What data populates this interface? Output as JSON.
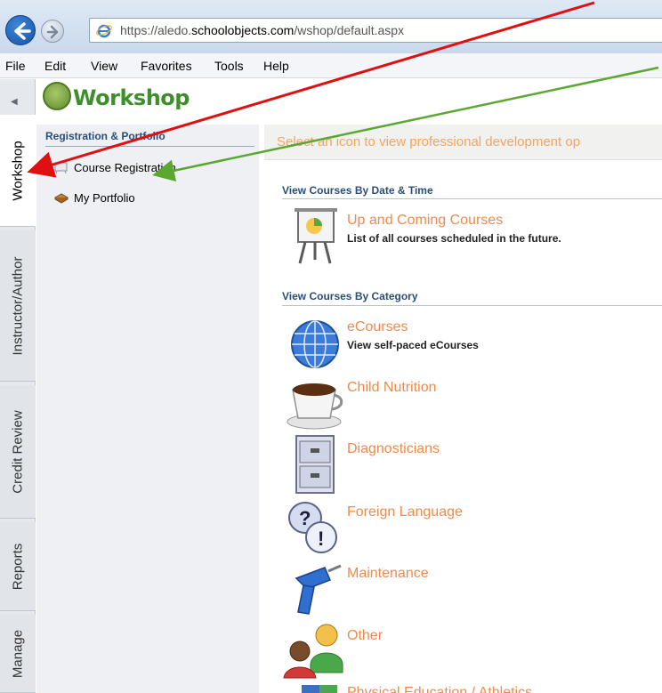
{
  "browser": {
    "url_prefix": "https://aledo.",
    "url_domain": "schoolobjects.com",
    "url_path": "/wshop/default.aspx"
  },
  "menu": [
    "File",
    "Edit",
    "View",
    "Favorites",
    "Tools",
    "Help"
  ],
  "side_tabs": [
    "Workshop",
    "Instructor/Author",
    "Credit Review",
    "Reports",
    "Manage"
  ],
  "app_title": "Workshop",
  "nav": {
    "header": "Registration & Portfolio",
    "items": [
      "Course Registration",
      "My Portfolio"
    ]
  },
  "banner": "Select an icon to view professional development op",
  "sections": {
    "by_date": {
      "title": "View Courses By Date & Time",
      "items": [
        {
          "title": "Up and Coming Courses",
          "desc": "List of all courses scheduled in the future.",
          "icon": "presentation-easel-icon"
        }
      ]
    },
    "by_category": {
      "title": "View Courses By Category",
      "items": [
        {
          "title": "eCourses",
          "desc": "View self-paced eCourses",
          "icon": "globe-icon"
        },
        {
          "title": "Child Nutrition",
          "icon": "coffee-cup-icon"
        },
        {
          "title": "Diagnosticians",
          "icon": "file-cabinet-icon"
        },
        {
          "title": "Foreign Language",
          "icon": "question-exclamation-bubbles-icon"
        },
        {
          "title": "Maintenance",
          "icon": "power-drill-icon"
        },
        {
          "title": "Other",
          "icon": "people-icon"
        },
        {
          "title": "Physical Education / Athletics",
          "icon": "sports-icon"
        }
      ]
    }
  },
  "colors": {
    "link_orange": "#f08a4b",
    "section_blue": "#2a4e7a",
    "annotation_red": "#e01010",
    "annotation_green": "#5aa832"
  }
}
